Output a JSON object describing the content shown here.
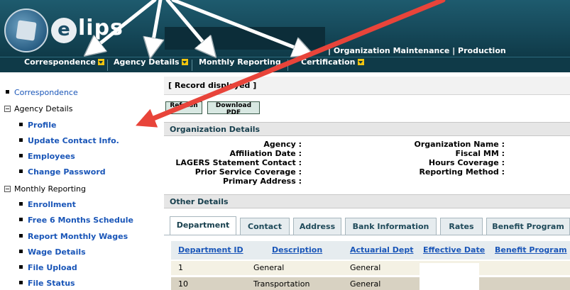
{
  "header": {
    "logo_text": "lips",
    "logo_e": "e",
    "links": "| Organization Maintenance  |  Production"
  },
  "nav": {
    "items": [
      {
        "label": "Correspondence"
      },
      {
        "label": "Agency Details"
      },
      {
        "label": "Monthly Reporting"
      },
      {
        "label": "Certification"
      }
    ]
  },
  "sidebar": {
    "correspondence": "Correspondence",
    "agency_details": "Agency Details",
    "agency_items": [
      "Profile",
      "Update Contact Info.",
      "Employees",
      "Change Password"
    ],
    "monthly_reporting": "Monthly Reporting",
    "monthly_items": [
      "Enrollment",
      "Free 6 Months Schedule",
      "Report Monthly Wages",
      "Wage Details",
      "File Upload",
      "File Status"
    ]
  },
  "main": {
    "record_status": "[ Record displayed ]",
    "refresh_button": "Refresh",
    "download_button": "Download PDF",
    "org_section": "Organization Details",
    "fields_left": [
      "Agency :",
      "Affiliation Date :",
      "LAGERS Statement Contact :",
      "Prior Service Coverage :",
      "Primary Address :"
    ],
    "fields_right": [
      "Organization Name :",
      "Fiscal MM :",
      "Hours Coverage :",
      "Reporting Method :"
    ],
    "other_section": "Other Details",
    "tabs": [
      "Department",
      "Contact",
      "Address",
      "Bank Information",
      "Rates",
      "Benefit Program"
    ],
    "table": {
      "headers": [
        "Department ID",
        "Description",
        "Actuarial Dept",
        "Effective Date",
        "Benefit Program"
      ],
      "rows": [
        [
          "1",
          "General",
          "General",
          "",
          ""
        ],
        [
          "10",
          "Transportation",
          "General",
          "",
          ""
        ]
      ]
    }
  },
  "colors": {
    "header_teal": "#16495a",
    "nav_dark": "#0f3a48",
    "link_blue": "#1a56b8",
    "arrow_red": "#e8443a",
    "arrow_white": "#ffffff"
  }
}
